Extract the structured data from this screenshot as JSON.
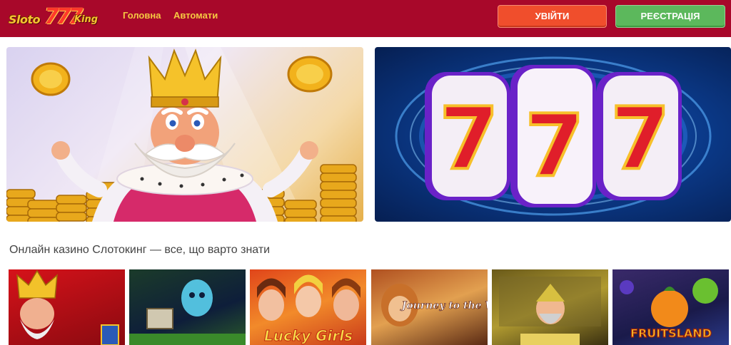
{
  "header": {
    "logo": {
      "part1": "Sloto",
      "part2": "777",
      "part3": "King"
    },
    "nav": [
      {
        "label": "Головна"
      },
      {
        "label": "Автомати"
      }
    ],
    "login_label": "УВІЙТИ",
    "register_label": "РЕЄСТРАЦІЯ"
  },
  "banners": [
    {
      "name": "king-coins-banner"
    },
    {
      "name": "lucky-777-banner"
    }
  ],
  "section": {
    "title": "Онлайн казино Слотокинг — все, що варто знати"
  },
  "game_tiles": [
    {
      "name": "game-tile-king"
    },
    {
      "name": "game-tile-ghost"
    },
    {
      "name": "game-tile-lucky-girls",
      "logo_text": "Lucky Girls"
    },
    {
      "name": "game-tile-journey-west",
      "logo_text": "Journey to the West"
    },
    {
      "name": "game-tile-dwarf"
    },
    {
      "name": "game-tile-fruitsland",
      "logo_text": "FRUITSLAND"
    }
  ],
  "colors": {
    "header_bg": "#a8082a",
    "nav_text": "#f5c842",
    "login_bg": "#f04e2c",
    "register_bg": "#5cb85c"
  }
}
